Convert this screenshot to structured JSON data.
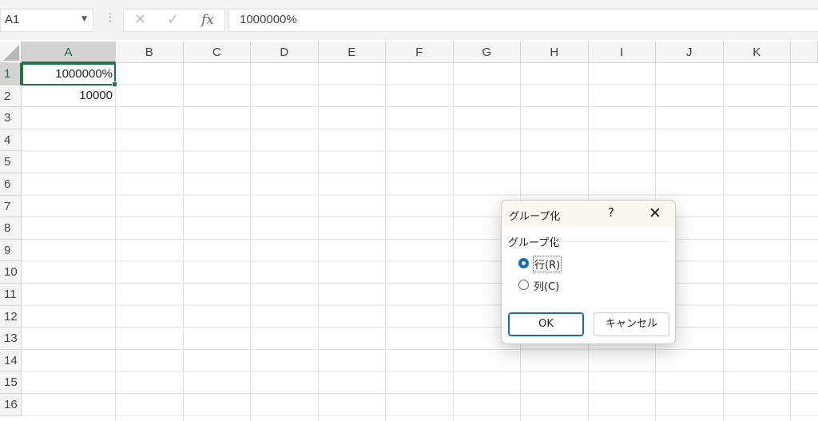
{
  "formula_bar": {
    "name_box": "A1",
    "dots": "⋮",
    "cancel_glyph": "✕",
    "enter_glyph": "✓",
    "fx_label": "fx",
    "formula": "1000000%"
  },
  "grid": {
    "columns": [
      "A",
      "B",
      "C",
      "D",
      "E",
      "F",
      "G",
      "H",
      "I",
      "J",
      "K"
    ],
    "rows": [
      "1",
      "2",
      "3",
      "4",
      "5",
      "6",
      "7",
      "8",
      "9",
      "10",
      "11",
      "12",
      "13",
      "14",
      "15",
      "16"
    ],
    "cells": {
      "A1": "1000000%",
      "A2": "10000"
    },
    "accent_color": "#217346"
  },
  "dialog": {
    "title": "グループ化",
    "help": "?",
    "close": "✕",
    "group_label": "グループ化",
    "options": [
      {
        "label": "行(R)",
        "selected": true
      },
      {
        "label": "列(C)",
        "selected": false
      }
    ],
    "ok_label": "OK",
    "cancel_label": "キャンセル",
    "accent_color": "#0f6cbd"
  }
}
